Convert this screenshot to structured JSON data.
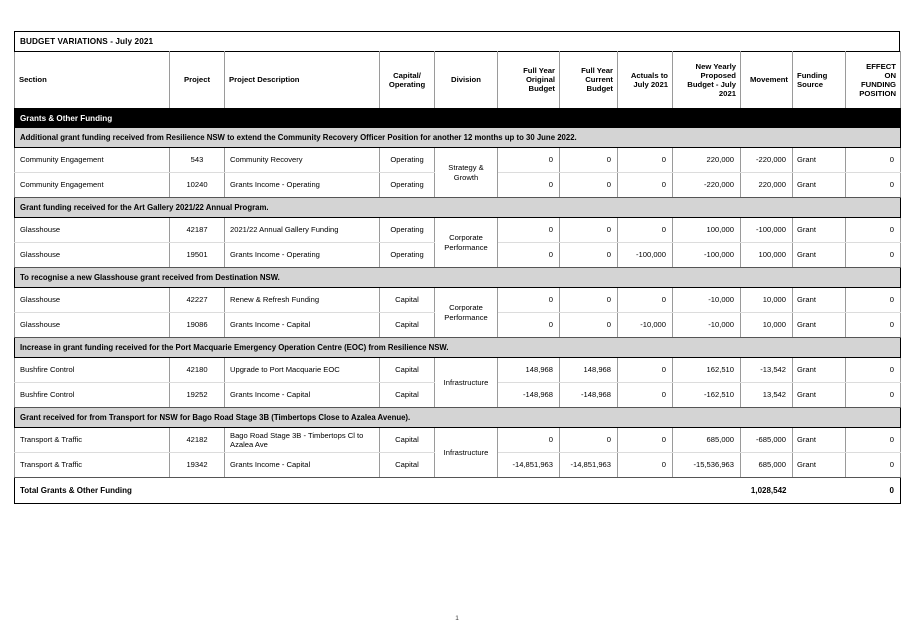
{
  "document": {
    "title": "BUDGET VARIATIONS - July 2021",
    "page_number": "1"
  },
  "table": {
    "columns": [
      {
        "key": "section",
        "label": "Section",
        "align": "left"
      },
      {
        "key": "project",
        "label": "Project",
        "align": "center"
      },
      {
        "key": "description",
        "label": "Project Description",
        "align": "left"
      },
      {
        "key": "capital_operating",
        "label": "Capital/\nOperating",
        "align": "center"
      },
      {
        "key": "division",
        "label": "Division",
        "align": "center"
      },
      {
        "key": "full_year_original_budget",
        "label": "Full Year\nOriginal\nBudget",
        "align": "right"
      },
      {
        "key": "full_year_current_budget",
        "label": "Full Year\nCurrent\nBudget",
        "align": "right"
      },
      {
        "key": "actuals_to_july_2021",
        "label": "Actuals to\nJuly 2021",
        "align": "right"
      },
      {
        "key": "new_yearly_proposed_budget",
        "label": "New Yearly\nProposed\nBudget - July\n2021",
        "align": "right"
      },
      {
        "key": "movement",
        "label": "Movement",
        "align": "right"
      },
      {
        "key": "funding_source",
        "label": "Funding\nSource",
        "align": "left"
      },
      {
        "key": "effect_on_funding_position",
        "label": "EFFECT\nON\nFUNDING\nPOSITION",
        "align": "right"
      }
    ],
    "group_banner": "Grants & Other Funding",
    "sections": [
      {
        "note": "Additional grant funding received from Resilience NSW to extend the Community Recovery Officer Position for another 12 months up to 30 June 2022.",
        "division": "Strategy &\nGrowth",
        "rows": [
          {
            "section": "Community Engagement",
            "project": "543",
            "description": "Community Recovery",
            "capital_operating": "Operating",
            "full_year_original_budget": "0",
            "full_year_current_budget": "0",
            "actuals_to_july_2021": "0",
            "new_yearly_proposed_budget": "220,000",
            "movement": "-220,000",
            "funding_source": "Grant",
            "effect_on_funding_position": "0"
          },
          {
            "section": "Community Engagement",
            "project": "10240",
            "description": "Grants Income - Operating",
            "capital_operating": "Operating",
            "full_year_original_budget": "0",
            "full_year_current_budget": "0",
            "actuals_to_july_2021": "0",
            "new_yearly_proposed_budget": "-220,000",
            "movement": "220,000",
            "funding_source": "Grant",
            "effect_on_funding_position": "0"
          }
        ]
      },
      {
        "note": "Grant funding received for the Art Gallery 2021/22 Annual Program.",
        "division": "Corporate\nPerformance",
        "rows": [
          {
            "section": "Glasshouse",
            "project": "42187",
            "description": "2021/22 Annual Gallery Funding",
            "capital_operating": "Operating",
            "full_year_original_budget": "0",
            "full_year_current_budget": "0",
            "actuals_to_july_2021": "0",
            "new_yearly_proposed_budget": "100,000",
            "movement": "-100,000",
            "funding_source": "Grant",
            "effect_on_funding_position": "0"
          },
          {
            "section": "Glasshouse",
            "project": "19501",
            "description": "Grants Income - Operating",
            "capital_operating": "Operating",
            "full_year_original_budget": "0",
            "full_year_current_budget": "0",
            "actuals_to_july_2021": "-100,000",
            "new_yearly_proposed_budget": "-100,000",
            "movement": "100,000",
            "funding_source": "Grant",
            "effect_on_funding_position": "0"
          }
        ]
      },
      {
        "note": "To recognise a new Glasshouse grant received from Destination NSW.",
        "division": "Corporate\nPerformance",
        "rows": [
          {
            "section": "Glasshouse",
            "project": "42227",
            "description": "Renew & Refresh Funding",
            "capital_operating": "Capital",
            "full_year_original_budget": "0",
            "full_year_current_budget": "0",
            "actuals_to_july_2021": "0",
            "new_yearly_proposed_budget": "-10,000",
            "movement": "10,000",
            "funding_source": "Grant",
            "effect_on_funding_position": "0"
          },
          {
            "section": "Glasshouse",
            "project": "19086",
            "description": "Grants Income - Capital",
            "capital_operating": "Capital",
            "full_year_original_budget": "0",
            "full_year_current_budget": "0",
            "actuals_to_july_2021": "-10,000",
            "new_yearly_proposed_budget": "-10,000",
            "movement": "10,000",
            "funding_source": "Grant",
            "effect_on_funding_position": "0"
          }
        ]
      },
      {
        "note": "Increase in grant funding received for the Port Macquarie Emergency Operation Centre (EOC) from Resilience NSW.",
        "division": "Infrastructure",
        "rows": [
          {
            "section": "Bushfire Control",
            "project": "42180",
            "description": "Upgrade to Port Macquarie EOC",
            "capital_operating": "Capital",
            "full_year_original_budget": "148,968",
            "full_year_current_budget": "148,968",
            "actuals_to_july_2021": "0",
            "new_yearly_proposed_budget": "162,510",
            "movement": "-13,542",
            "funding_source": "Grant",
            "effect_on_funding_position": "0"
          },
          {
            "section": "Bushfire Control",
            "project": "19252",
            "description": "Grants Income - Capital",
            "capital_operating": "Capital",
            "full_year_original_budget": "-148,968",
            "full_year_current_budget": "-148,968",
            "actuals_to_july_2021": "0",
            "new_yearly_proposed_budget": "-162,510",
            "movement": "13,542",
            "funding_source": "Grant",
            "effect_on_funding_position": "0"
          }
        ]
      },
      {
        "note": "Grant received for from Transport for NSW for Bago Road Stage 3B (Timbertops Close to Azalea Avenue).",
        "division": "Infrastructure",
        "rows": [
          {
            "section": "Transport & Traffic",
            "project": "42182",
            "description": "Bago Road Stage 3B - Timbertops Cl to Azalea Ave",
            "capital_operating": "Capital",
            "full_year_original_budget": "0",
            "full_year_current_budget": "0",
            "actuals_to_july_2021": "0",
            "new_yearly_proposed_budget": "685,000",
            "movement": "-685,000",
            "funding_source": "Grant",
            "effect_on_funding_position": "0"
          },
          {
            "section": "Transport & Traffic",
            "project": "19342",
            "description": "Grants Income - Capital",
            "capital_operating": "Capital",
            "full_year_original_budget": "-14,851,963",
            "full_year_current_budget": "-14,851,963",
            "actuals_to_july_2021": "0",
            "new_yearly_proposed_budget": "-15,536,963",
            "movement": "685,000",
            "funding_source": "Grant",
            "effect_on_funding_position": "0"
          }
        ]
      }
    ],
    "total_row": {
      "label": "Total Grants & Other Funding",
      "movement": "1,028,542",
      "effect_on_funding_position": "0"
    }
  }
}
